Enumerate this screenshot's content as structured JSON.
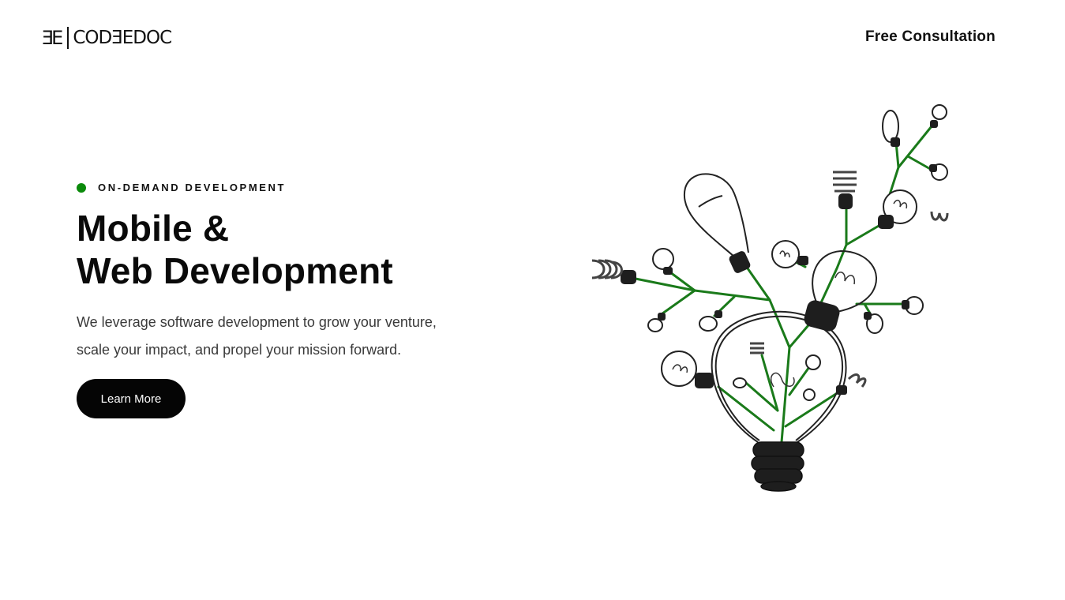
{
  "header": {
    "logo_mark": "ƎE",
    "logo_text": "CODƎEDOC",
    "consult_label": "Free Consultation"
  },
  "hero": {
    "eyebrow": "ON-DEMAND DEVELOPMENT",
    "headline_line1": "Mobile &",
    "headline_line2": "Web Development",
    "desc_line1": "We leverage software development to grow your venture,",
    "desc_line2": "scale your impact, and propel your mission forward.",
    "cta_label": "Learn More"
  },
  "colors": {
    "accent": "#0b8a0b",
    "button_bg": "#050505",
    "text": "#111111"
  }
}
